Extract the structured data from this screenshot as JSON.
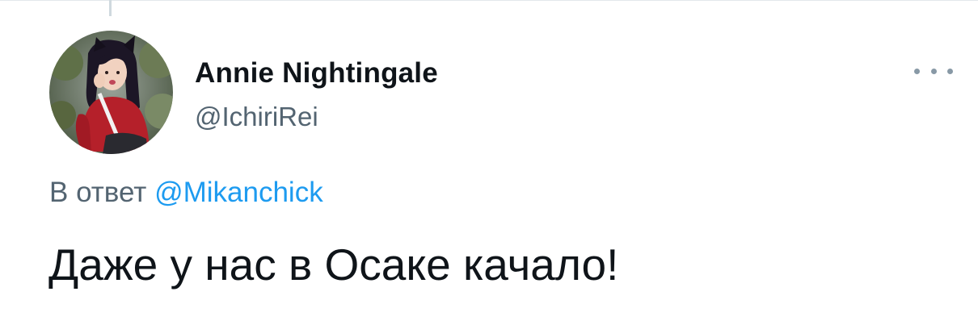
{
  "tweet": {
    "author": {
      "display_name": "Annie Nightingale",
      "handle": "@IchiriRei",
      "avatar": "avatar-photo"
    },
    "reply_to": {
      "prefix": "В ответ",
      "mention": "@Mikanchick"
    },
    "text": "Даже у нас в Осаке качало!",
    "menu_icon": "more-dots-icon"
  },
  "colors": {
    "text_primary": "#0f1419",
    "text_secondary": "#536471",
    "link": "#1d9bf0",
    "icon_gray": "#8899a6"
  }
}
